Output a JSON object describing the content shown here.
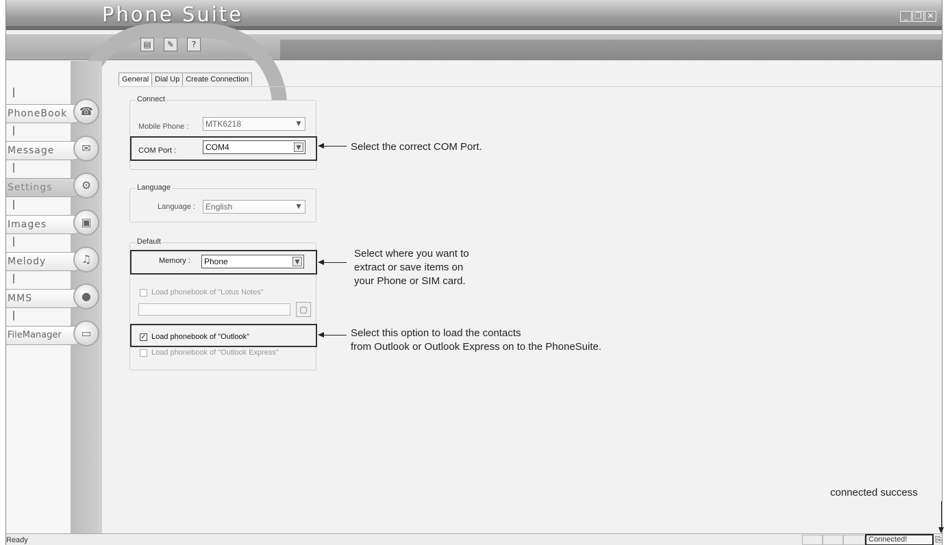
{
  "window": {
    "title": "Phone Suite",
    "controls": [
      "_",
      "❐",
      "✕"
    ]
  },
  "toolbar": {
    "buttons": [
      {
        "icon": "document-icon",
        "glyph": "▤"
      },
      {
        "icon": "edit-icon",
        "glyph": "✎"
      },
      {
        "icon": "help-icon",
        "glyph": "?"
      }
    ]
  },
  "sidebar": {
    "items": [
      {
        "label": "PhoneBook",
        "icon": "phone-icon",
        "glyph": "☎"
      },
      {
        "label": "Message",
        "icon": "envelope-icon",
        "glyph": "✉"
      },
      {
        "label": "Settings",
        "icon": "settings-icon",
        "glyph": "⚙"
      },
      {
        "label": "Images",
        "icon": "image-icon",
        "glyph": "▣"
      },
      {
        "label": "Melody",
        "icon": "music-icon",
        "glyph": "♫"
      },
      {
        "label": "MMS",
        "icon": "balloon-icon",
        "glyph": "●"
      },
      {
        "label": "FileManager",
        "icon": "folder-icon",
        "glyph": "▭"
      }
    ]
  },
  "tabs": [
    "General",
    "Dial Up",
    "Create Connection"
  ],
  "connect": {
    "legend": "Connect",
    "mobile_phone_label": "Mobile Phone :",
    "mobile_phone_value": "MTK6218",
    "com_port_label": "COM Port :",
    "com_port_value": "COM4"
  },
  "language": {
    "legend": "Language",
    "label": "Language :",
    "value": "English"
  },
  "default": {
    "legend": "Default",
    "memory_label": "Memory :",
    "memory_value": "Phone",
    "lotus_label": "Load phonebook of \"Lotus Notes\"",
    "lotus_checked": false,
    "outlook_label": "Load phonebook of \"Outlook\"",
    "outlook_checked": true,
    "outlook_express_label": "Load phonebook of \"Outlook Express\"",
    "outlook_express_checked": false
  },
  "annotations": {
    "com_port": "Select the correct COM Port.",
    "memory_line1": "Select where you want to",
    "memory_line2": "extract or save items on",
    "memory_line3": "your Phone or SIM card.",
    "outlook_line1": "Select this option to load the contacts",
    "outlook_line2": "from Outlook or Outlook Express on to the PhoneSuite.",
    "connected": "connected success"
  },
  "statusbar": {
    "ready": "Ready",
    "connection": "Connected!"
  }
}
